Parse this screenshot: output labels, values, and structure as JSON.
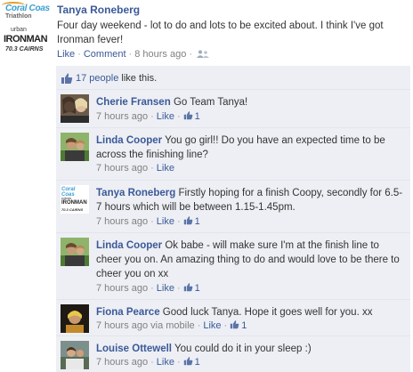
{
  "post": {
    "author": "Tanya Roneberg",
    "text": "Four day weekend - lot to do and lots to be excited about. I think I've got Ironman fever!",
    "avatar_logo": {
      "line1": "Coral Coas",
      "line2": "Triathlon",
      "urban": "urban",
      "brand": "IRONMAN",
      "sub": "70.3 CAIRNS"
    },
    "actions": {
      "like": "Like",
      "comment": "Comment",
      "timestamp": "8 hours ago",
      "audience_icon": "people-icon"
    }
  },
  "likes": {
    "count_text": "17 people",
    "suffix": " like this."
  },
  "comments": [
    {
      "author": "Cherie Fransen",
      "text": "Go Team Tanya!",
      "time": "7 hours ago",
      "like": "Like",
      "likes": "1",
      "avatar": "photo"
    },
    {
      "author": "Linda Cooper",
      "text": "You go girl!! Do you have an expected time to be across the finishing line?",
      "time": "7 hours ago",
      "like": "Like",
      "likes": "",
      "avatar": "photo"
    },
    {
      "author": "Tanya Roneberg",
      "text": "Firstly hoping for a finish Coopy, secondly for 6.5-7 hours which will be between 1.15-1.45pm.",
      "time": "7 hours ago",
      "like": "Like",
      "likes": "1",
      "avatar": "logo"
    },
    {
      "author": "Linda Cooper",
      "text": "Ok babe - will make sure I'm at the finish line to cheer you on. An amazing thing to do and would love to be there to cheer you on xx",
      "time": "7 hours ago",
      "like": "Like",
      "likes": "1",
      "avatar": "photo"
    },
    {
      "author": "Fiona Pearce",
      "text": "Good luck Tanya. Hope it goes well for you. xx",
      "time": "7 hours ago via mobile",
      "like": "Like",
      "likes": "1",
      "avatar": "photo"
    },
    {
      "author": "Louise Ottewell",
      "text": "You could do it in your sleep :)",
      "time": "7 hours ago",
      "like": "Like",
      "likes": "1",
      "avatar": "photo"
    }
  ],
  "colors": {
    "link": "#3b5998",
    "meta": "#808080",
    "panel": "#edeff4",
    "divider": "#e2e5ec"
  }
}
